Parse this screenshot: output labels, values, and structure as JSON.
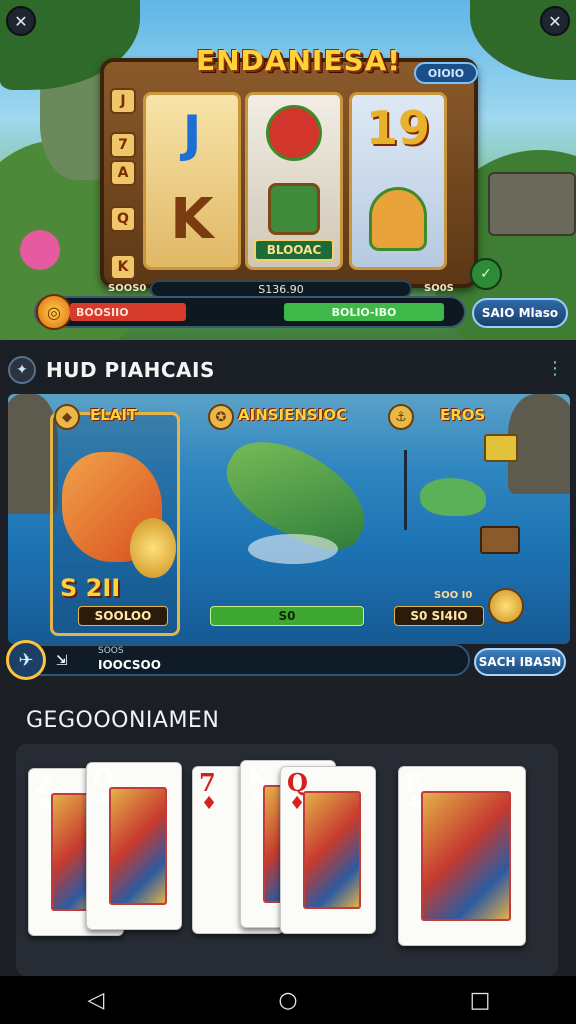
{
  "slot": {
    "title": "ENDANIESA!",
    "top_badge": "OIOIO",
    "reel_caption": "BLOOAC",
    "reel_numbers": "19",
    "bar_center": "S136.90",
    "bar_left_stat": "SOOS0",
    "bar_right_stat": "SO0S",
    "red_label": "BOOSIIO",
    "green_label": "BOLIO-IBO",
    "spin_label": "SAIO Mlaso",
    "side_icons": [
      "J",
      "7",
      "A",
      "Q",
      "K"
    ],
    "colors": {
      "gold": "#ffd23a",
      "wood": "#8b5a2b",
      "red": "#d63a2a",
      "green": "#3fb84a"
    }
  },
  "fish": {
    "header_title": "HUD PIAHCAIS",
    "panels": [
      {
        "title": "ELAIT",
        "amount": "S 2II",
        "plate": "SOOLOO"
      },
      {
        "title": "AINSIENSIOC",
        "plate": "S0"
      },
      {
        "title": "EROS",
        "plate": "S0 SI4IO"
      }
    ],
    "side_plate": "SOO I0",
    "bar_small": "SOOS",
    "bar_value": "IOOCSOO",
    "action_label": "SACH IBASN"
  },
  "cards": {
    "title": "GEGOOONIAMEN",
    "hand": [
      {
        "rank": "Z",
        "suit": "♠",
        "color": "blk"
      },
      {
        "rank": "Q",
        "suit": "♣",
        "color": "blk"
      },
      {
        "rank": "7",
        "suit": "♦",
        "color": "red"
      },
      {
        "rank": "K",
        "suit": "♠",
        "color": "blk"
      },
      {
        "rank": "Q",
        "suit": "♦",
        "color": "red"
      },
      {
        "rank": "K",
        "suit": "♣",
        "color": "blk"
      }
    ]
  },
  "nav": {
    "back": "◁",
    "home": "○",
    "recent": "□"
  }
}
